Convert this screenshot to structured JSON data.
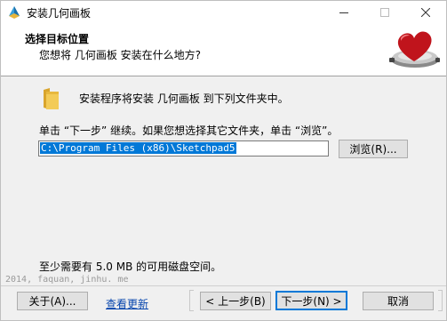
{
  "window": {
    "title": "安装几何画板",
    "controls": {
      "minimize": "minimize-icon",
      "maximize": "maximize-icon",
      "close": "close-icon"
    }
  },
  "header": {
    "title": "选择目标位置",
    "subtitle": "您想将 几何画板 安装在什么地方?"
  },
  "content": {
    "intro": "安装程序将安装 几何画板 到下列文件夹中。",
    "instruction": "单击 “下一步” 继续。如果您想选择其它文件夹，单击 “浏览”。",
    "path_value": "C:\\Program Files (x86)\\Sketchpad5",
    "browse_label": "浏览(R)...",
    "space_required": "至少需要有 5.0 MB 的可用磁盘空间。"
  },
  "watermark": "2014, faquan, jinhu. me",
  "footer": {
    "about_label": "关于(A)...",
    "check_update_label": "查看更新",
    "back_label": "< 上一步(B)",
    "next_label": "下一步(N) >",
    "cancel_label": "取消"
  },
  "colors": {
    "accent": "#0078d7",
    "link": "#0645ad",
    "header_bg": "#ffffff",
    "body_bg": "#f0f0f0"
  }
}
